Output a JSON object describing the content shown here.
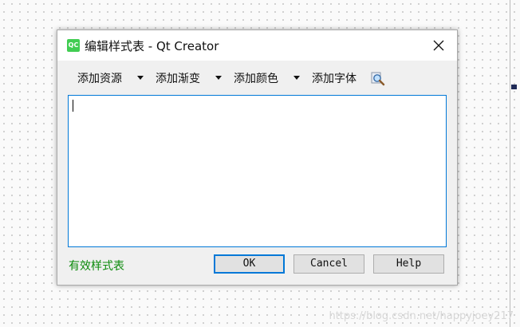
{
  "dialog": {
    "title": "编辑样式表 - Qt Creator",
    "app_icon_text": "QC",
    "toolbar": {
      "add_resource": "添加资源",
      "add_gradient": "添加渐变",
      "add_color": "添加颜色",
      "add_font": "添加字体"
    },
    "editor": {
      "text": ""
    },
    "status": "有效样式表",
    "buttons": {
      "ok": "OK",
      "cancel": "Cancel",
      "help": "Help"
    }
  },
  "background": {
    "watermark": "https://blog.csdn.net/happyjoey217"
  },
  "icons": [
    "qt-creator-icon",
    "close-icon",
    "dropdown-arrow-icon",
    "find-icon"
  ],
  "colors": {
    "focus": "#0078d7",
    "status_valid": "#0a8a0a",
    "qt_green": "#41cd52"
  }
}
